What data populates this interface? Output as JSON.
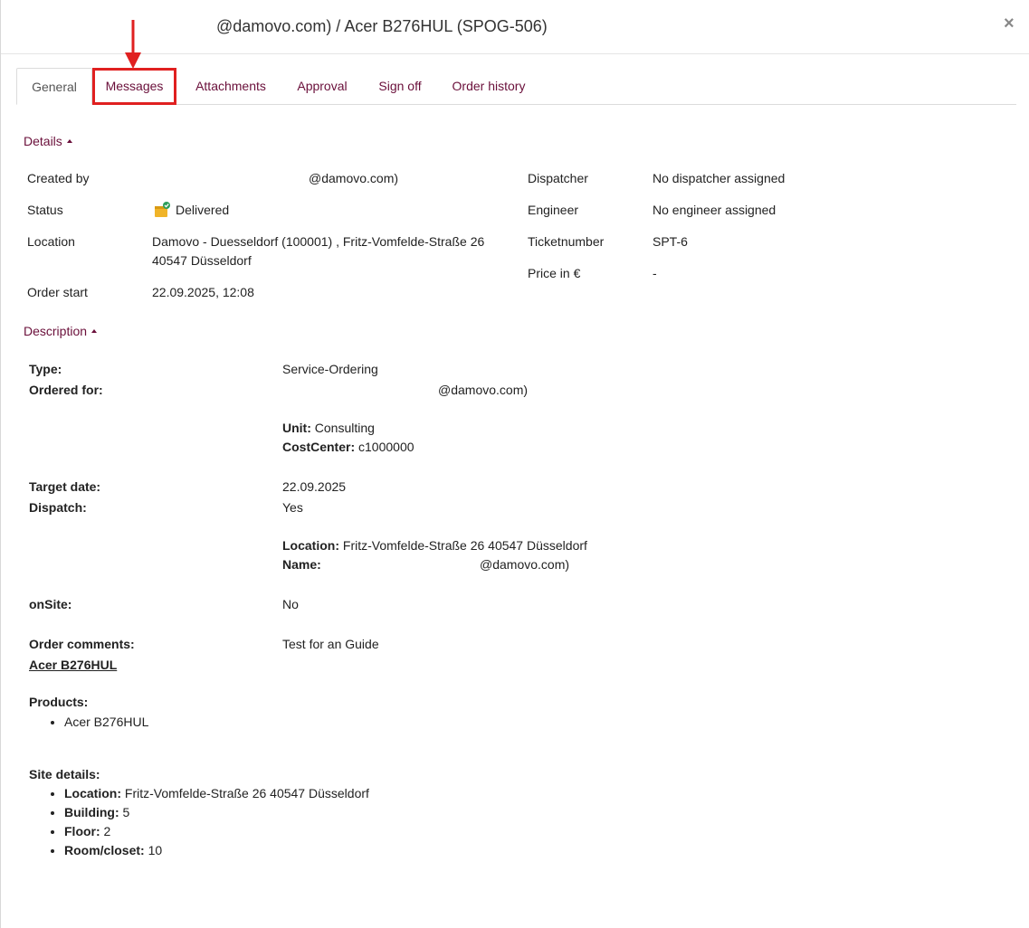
{
  "header": {
    "title": "@damovo.com) / Acer B276HUL (SPOG-506)",
    "close_icon": "close-icon"
  },
  "tabs": [
    {
      "label": "General",
      "active": true
    },
    {
      "label": "Messages",
      "active": false,
      "highlighted": true
    },
    {
      "label": "Attachments",
      "active": false
    },
    {
      "label": "Approval",
      "active": false
    },
    {
      "label": "Sign off",
      "active": false
    },
    {
      "label": "Order history",
      "active": false
    }
  ],
  "annotation": {
    "highlight_color": "#e02020"
  },
  "details": {
    "toggle_label": "Details",
    "created_by_label": "Created by",
    "created_by_value": "@damovo.com)",
    "status_label": "Status",
    "status_value": "Delivered",
    "status_icon": "delivered-box-check-icon",
    "location_label": "Location",
    "location_line1": "Damovo - Duesseldorf (100001) , Fritz-Vomfelde-Straße 26",
    "location_line2": "40547 Düsseldorf",
    "order_start_label": "Order start",
    "order_start_value": "22.09.2025, 12:08",
    "dispatcher_label": "Dispatcher",
    "dispatcher_value": "No dispatcher assigned",
    "engineer_label": "Engineer",
    "engineer_value": "No engineer assigned",
    "ticketnumber_label": "Ticketnumber",
    "ticketnumber_value": "SPT-6",
    "price_label": "Price in €",
    "price_value": "-"
  },
  "description": {
    "toggle_label": "Description",
    "type_label": "Type:",
    "type_value": "Service-Ordering",
    "ordered_for_label": "Ordered for:",
    "ordered_for_value": "@damovo.com)",
    "unit_label": "Unit:",
    "unit_value": "Consulting",
    "costcenter_label": "CostCenter:",
    "costcenter_value": "c1000000",
    "target_date_label": "Target date:",
    "target_date_value": "22.09.2025",
    "dispatch_label": "Dispatch:",
    "dispatch_value": "Yes",
    "dispatch_location_label": "Location:",
    "dispatch_location_value": "Fritz-Vomfelde-Straße 26 40547 Düsseldorf",
    "dispatch_name_label": "Name:",
    "dispatch_name_value": "@damovo.com)",
    "onsite_label": "onSite:",
    "onsite_value": "No",
    "order_comments_label": "Order comments:",
    "order_comments_value": "Test for an Guide",
    "product_link": "Acer B276HUL",
    "products_label": "Products:",
    "products": [
      "Acer B276HUL"
    ],
    "site_details_label": "Site details:",
    "site_details": [
      {
        "label": "Location:",
        "value": "Fritz-Vomfelde-Straße 26 40547 Düsseldorf"
      },
      {
        "label": "Building:",
        "value": "5"
      },
      {
        "label": "Floor:",
        "value": "2"
      },
      {
        "label": "Room/closet:",
        "value": "10"
      }
    ]
  },
  "colors": {
    "accent": "#6a0f3a",
    "text": "#222222",
    "status_box": "#f0b429",
    "status_check": "#2e9e5b"
  }
}
